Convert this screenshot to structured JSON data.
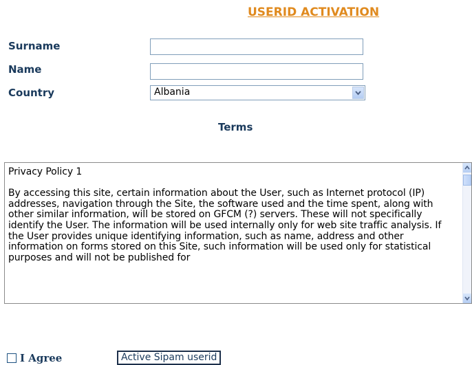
{
  "header": {
    "title": "USERID ACTIVATION"
  },
  "form": {
    "surname_label": "Surname",
    "name_label": "Name",
    "country_label": "Country",
    "country_value": "Albania",
    "surname_value": "",
    "name_value": ""
  },
  "terms": {
    "heading": "Terms",
    "text": "Privacy Policy 1\n\nBy accessing this site, certain information about the User, such as Internet protocol (IP) addresses, navigation through the Site, the software used and the time spent, along with other similar information, will be stored on GFCM (?) servers. These will not specifically identify the User. The information will be used internally only for web site traffic analysis. If the User provides unique identifying information, such as name, address and other information on forms stored on this Site, such information will be used only for statistical purposes and will not be published for"
  },
  "footer": {
    "agree_label": "I Agree",
    "activate_button": "Active Sipam userid"
  },
  "icons": {
    "select_arrow": "chevron-down-icon",
    "scroll_up": "arrow-up-icon",
    "scroll_down": "arrow-down-icon"
  },
  "colors": {
    "title": "#e08a1e",
    "label": "#1a3a5c",
    "border": "#7f9db9"
  }
}
